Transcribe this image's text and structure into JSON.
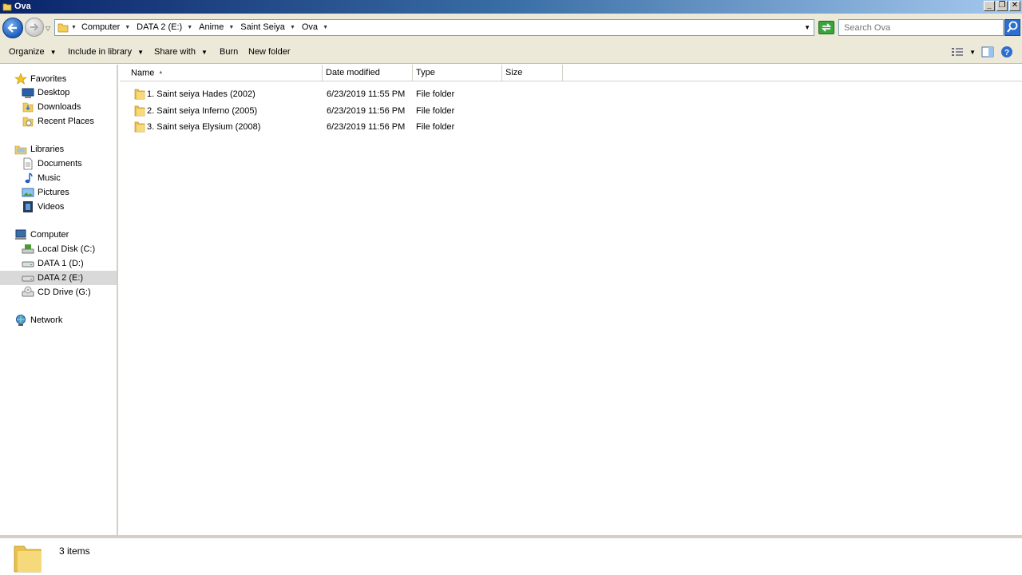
{
  "window": {
    "title": "Ova"
  },
  "address": {
    "crumbs": [
      "Computer",
      "DATA 2 (E:)",
      "Anime",
      "Saint Seiya",
      "Ova"
    ]
  },
  "search": {
    "placeholder": "Search Ova"
  },
  "toolbar": {
    "organize": "Organize",
    "include_library": "Include in library",
    "share_with": "Share with",
    "burn": "Burn",
    "new_folder": "New folder"
  },
  "nav": {
    "favorites": {
      "label": "Favorites",
      "items": [
        "Desktop",
        "Downloads",
        "Recent Places"
      ]
    },
    "libraries": {
      "label": "Libraries",
      "items": [
        "Documents",
        "Music",
        "Pictures",
        "Videos"
      ]
    },
    "computer": {
      "label": "Computer",
      "items": [
        "Local Disk (C:)",
        "DATA 1 (D:)",
        "DATA 2 (E:)",
        "CD Drive (G:)"
      ],
      "selected": "DATA 2 (E:)"
    },
    "network": {
      "label": "Network"
    }
  },
  "columns": {
    "name": "Name",
    "date": "Date modified",
    "type": "Type",
    "size": "Size"
  },
  "files": [
    {
      "name": "1. Saint seiya Hades (2002)",
      "date": "6/23/2019 11:55 PM",
      "type": "File folder"
    },
    {
      "name": "2. Saint seiya Inferno (2005)",
      "date": "6/23/2019 11:56 PM",
      "type": "File folder"
    },
    {
      "name": "3. Saint seiya Elysium (2008)",
      "date": "6/23/2019 11:56 PM",
      "type": "File folder"
    }
  ],
  "status": {
    "count": "3 items"
  },
  "colors": {
    "folder": "#e8c14a",
    "accent": "#1b5fbf",
    "selection": "#d9d9d9"
  }
}
